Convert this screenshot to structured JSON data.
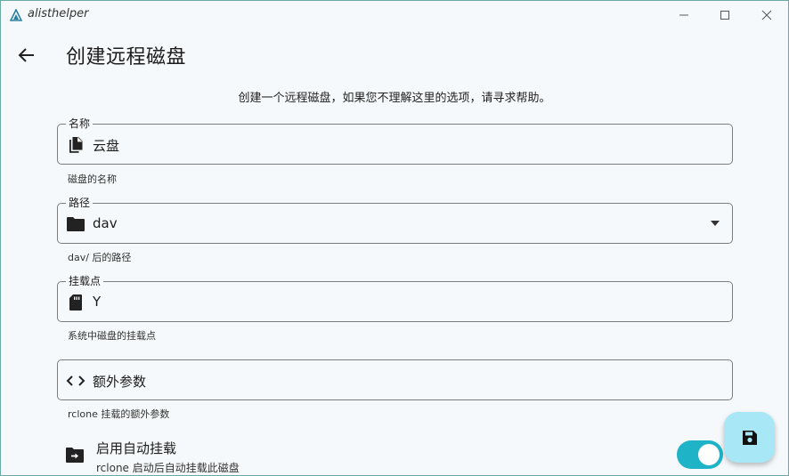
{
  "window": {
    "app_title": "alisthelper"
  },
  "page": {
    "title": "创建远程磁盘",
    "intro": "创建一个远程磁盘，如果您不理解这里的选项，请寻求帮助。"
  },
  "fields": {
    "name": {
      "label": "名称",
      "value": "云盘",
      "helper": "磁盘的名称",
      "icon": "copy-icon"
    },
    "path": {
      "label": "路径",
      "value": "dav",
      "helper": "dav/ 后的路径",
      "icon": "folder-icon"
    },
    "mount": {
      "label": "挂载点",
      "value": "Y",
      "helper": "系统中磁盘的挂载点",
      "icon": "sd-card-icon"
    },
    "extra": {
      "placeholder": "额外参数",
      "helper": "rclone 挂载的额外参数",
      "icon": "code-icon"
    }
  },
  "automount": {
    "title": "启用自动挂载",
    "subtitle": "rclone 启动后自动挂载此磁盘",
    "enabled": true
  },
  "colors": {
    "accent": "#1fb3c7",
    "fab": "#a8e8f6",
    "background": "#f5f9fb"
  }
}
